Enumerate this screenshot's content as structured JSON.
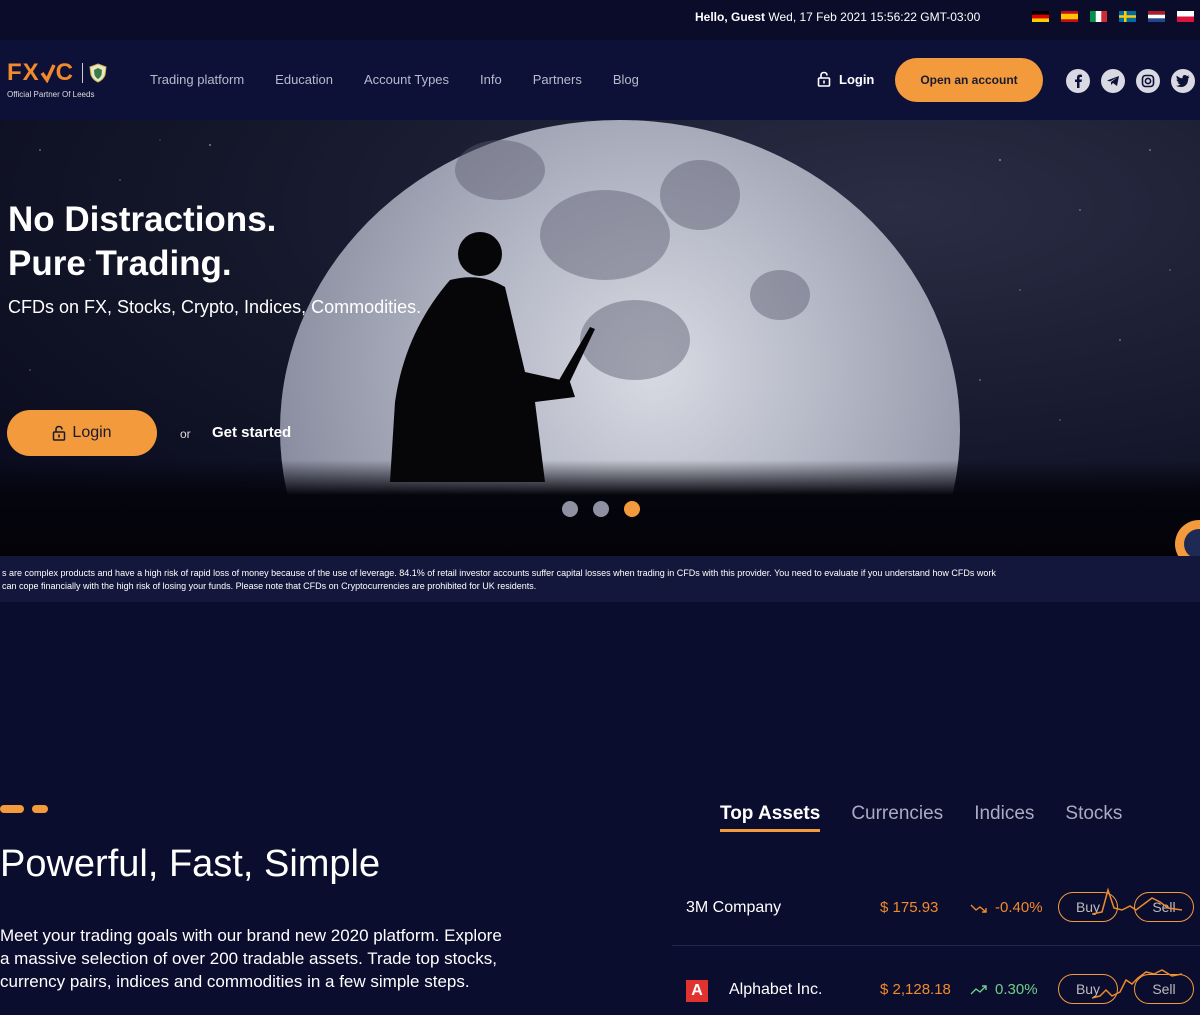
{
  "topbar": {
    "greeting_bold": "Hello, Guest",
    "datetime": "Wed, 17 Feb 2021 15:56:22 GMT-03:00",
    "flags": [
      "germany-flag",
      "spain-flag",
      "italy-flag",
      "sweden-flag",
      "netherlands-flag",
      "poland-flag"
    ]
  },
  "nav": {
    "logo_text": "FX",
    "logo_text2": "C",
    "logo_sub": "Official Partner Of Leeds",
    "menu": [
      "Trading platform",
      "Education",
      "Account Types",
      "Info",
      "Partners",
      "Blog"
    ],
    "login": "Login",
    "open_account": "Open an account",
    "socials": [
      "facebook-icon",
      "telegram-icon",
      "instagram-icon",
      "twitter-icon"
    ]
  },
  "hero": {
    "title_line1": "No Distractions.",
    "title_line2": "Pure Trading.",
    "subtitle": "CFDs on FX, Stocks, Crypto, Indices, Commodities.",
    "login": "Login",
    "or": "or",
    "get_started": "Get started",
    "slides": 3,
    "active_slide": 3
  },
  "risk": {
    "line1": "s are complex products and have a high risk of rapid loss of money because of the use of leverage. 84.1% of retail investor accounts suffer capital losses when trading in CFDs with this provider. You need to evaluate if you understand how CFDs work",
    "line2": "can cope financially with the high risk of losing your funds. Please note that CFDs on Cryptocurrencies are prohibited for UK residents."
  },
  "section": {
    "title": "Powerful, Fast, Simple",
    "text": "Meet your trading goals with our brand new 2020 platform. Explore a massive selection of over 200 tradable assets. Trade top stocks, currency pairs, indices and commodities in a few simple steps."
  },
  "tabs": [
    "Top Assets",
    "Currencies",
    "Indices",
    "Stocks"
  ],
  "assets": [
    {
      "name": "3M Company",
      "price": "$ 175.93",
      "change": "-0.40%",
      "buy": "Buy",
      "sell": "Sell"
    },
    {
      "logo": "A",
      "name": "Alphabet Inc.",
      "price": "$ 2,128.18",
      "change": "0.30%",
      "buy": "Buy",
      "sell": "Sell"
    }
  ],
  "colors": {
    "accent": "#f39b3c",
    "background": "#0b0d2e",
    "nav": "#0e1137",
    "positive": "#6fd08a"
  }
}
